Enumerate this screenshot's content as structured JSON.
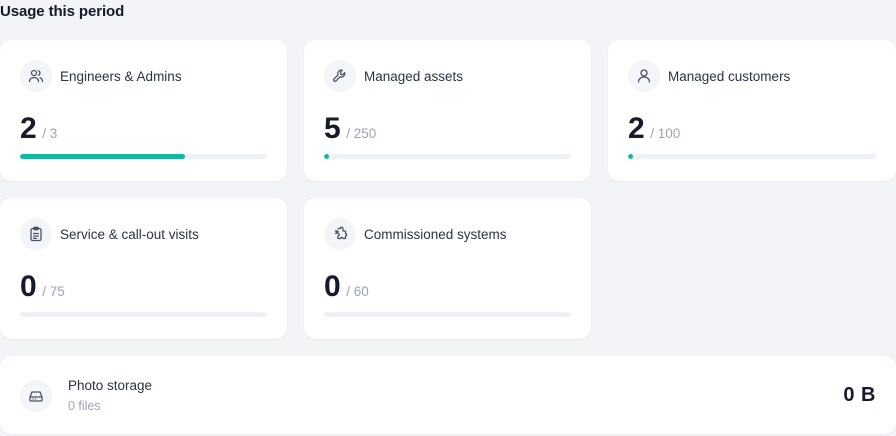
{
  "section_title": "Usage this period",
  "accent_color": "#14b8a0",
  "cards": [
    {
      "label": "Engineers & Admins",
      "icon": "users-icon",
      "value": "2",
      "limit": "/ 3",
      "progress": 0.667
    },
    {
      "label": "Managed assets",
      "icon": "wrench-icon",
      "value": "5",
      "limit": "/ 250",
      "progress": 0.02
    },
    {
      "label": "Managed customers",
      "icon": "user-icon",
      "value": "2",
      "limit": "/ 100",
      "progress": 0.02
    },
    {
      "label": "Service & call-out visits",
      "icon": "clipboard-icon",
      "value": "0",
      "limit": "/ 75",
      "progress": 0
    },
    {
      "label": "Commissioned systems",
      "icon": "puzzle-icon",
      "value": "0",
      "limit": "/ 60",
      "progress": 0
    }
  ],
  "storage": {
    "label": "Photo storage",
    "icon": "hard-drive-icon",
    "files": "0 files",
    "value": "0 B"
  }
}
